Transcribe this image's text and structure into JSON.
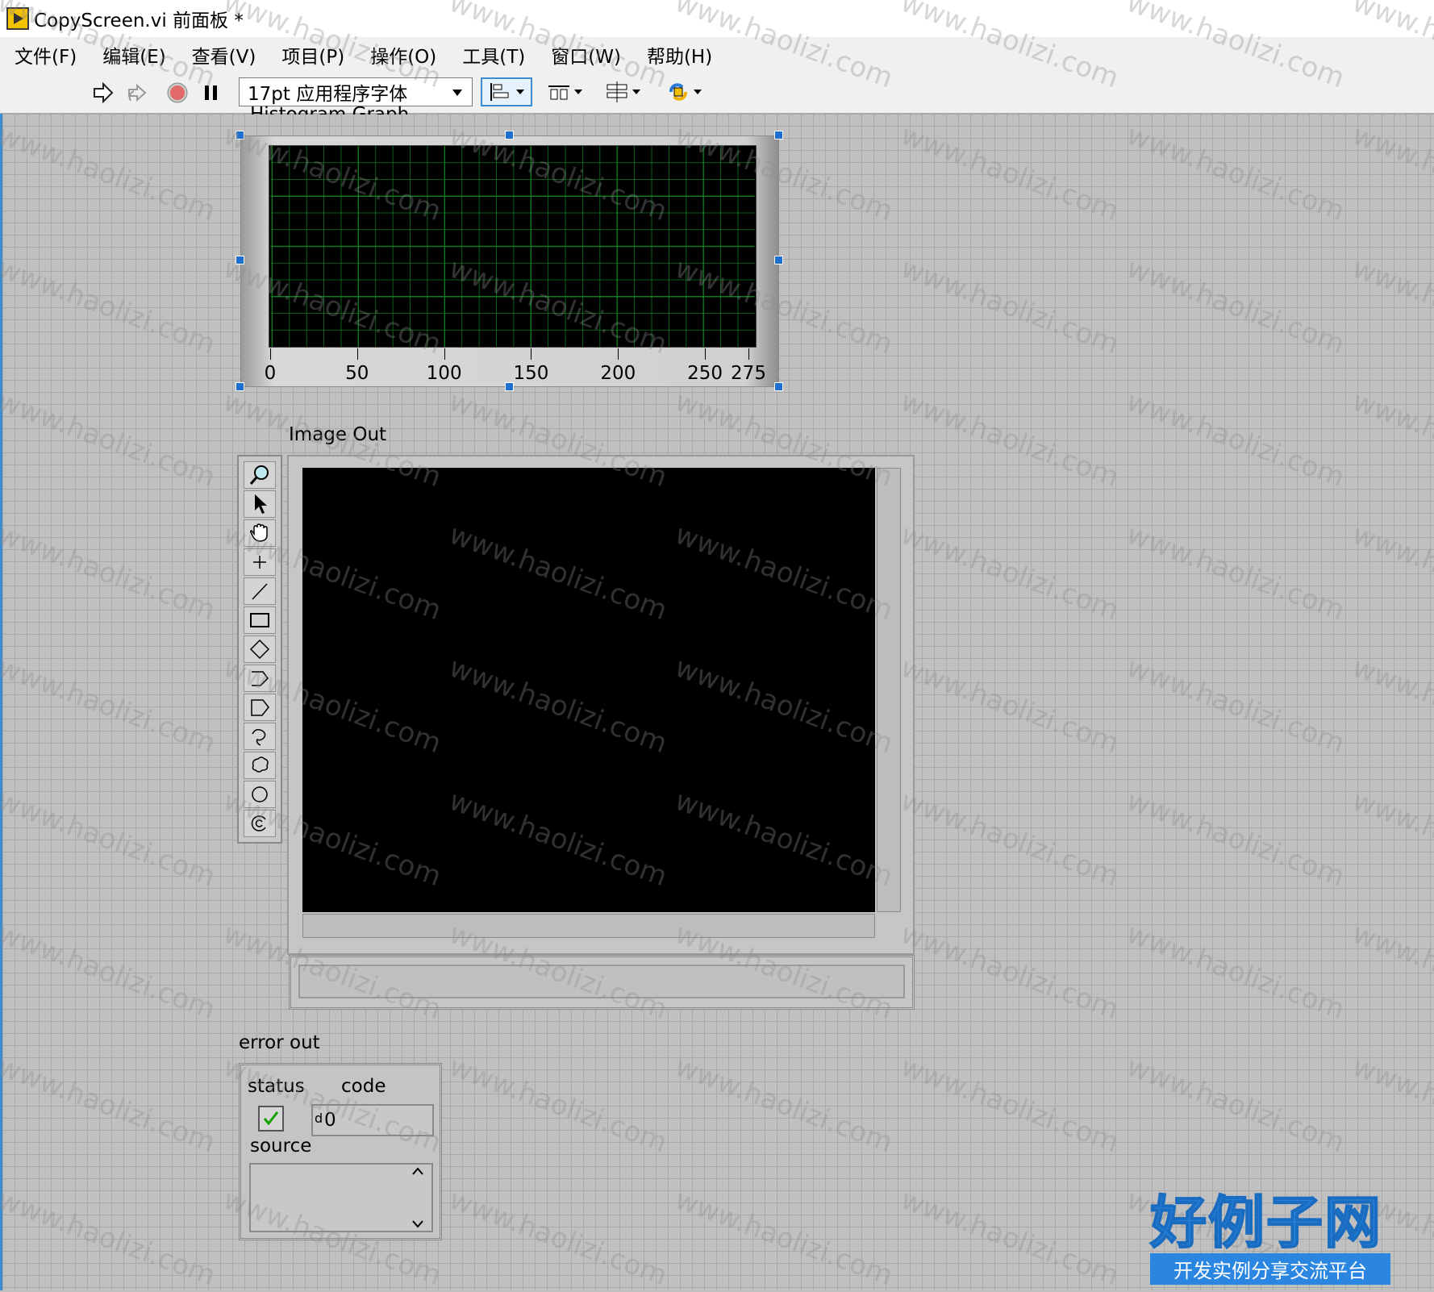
{
  "window": {
    "title": "CopyScreen.vi 前面板 *"
  },
  "menu": [
    "文件(F)",
    "编辑(E)",
    "查看(V)",
    "项目(P)",
    "操作(O)",
    "工具(T)",
    "窗口(W)",
    "帮助(H)"
  ],
  "toolbar": {
    "font_select": "17pt 应用程序字体",
    "buttons": [
      "run-arrow-icon",
      "run-continuously-icon",
      "abort-icon",
      "pause-icon"
    ],
    "dropdowns": [
      "align-objects-icon",
      "distribute-objects-icon",
      "resize-objects-icon",
      "reorder-icon"
    ]
  },
  "histogram": {
    "label": "Histogram Graph",
    "x_ticks": [
      "0",
      "50",
      "100",
      "150",
      "200",
      "250",
      "275"
    ]
  },
  "chart_data": {
    "type": "bar",
    "title": "Histogram Graph",
    "xlabel": "",
    "ylabel": "",
    "xlim": [
      0,
      275
    ],
    "x_ticks": [
      0,
      50,
      100,
      150,
      200,
      250,
      275
    ],
    "values": [],
    "grid": true,
    "colors": {
      "plot_bg": "#000000",
      "grid": "#0f7a22"
    }
  },
  "image_out": {
    "label": "Image Out",
    "tools": [
      "zoom-icon",
      "pointer-icon",
      "pan-hand-icon",
      "point-icon",
      "line-icon",
      "rectangle-icon",
      "rotated-rectangle-icon",
      "polyline-icon",
      "polygon-icon",
      "freehand-line-icon",
      "freehand-region-icon",
      "oval-icon",
      "annulus-icon"
    ]
  },
  "error_out": {
    "label": "error out",
    "status_label": "status",
    "code_label": "code",
    "code_radix": "d",
    "code_value": "0",
    "source_label": "source",
    "status_ok": true
  },
  "watermark": {
    "text": "www.haolizi.com",
    "logo_main": "好例子网",
    "logo_sub": "开发实例分享交流平台"
  }
}
